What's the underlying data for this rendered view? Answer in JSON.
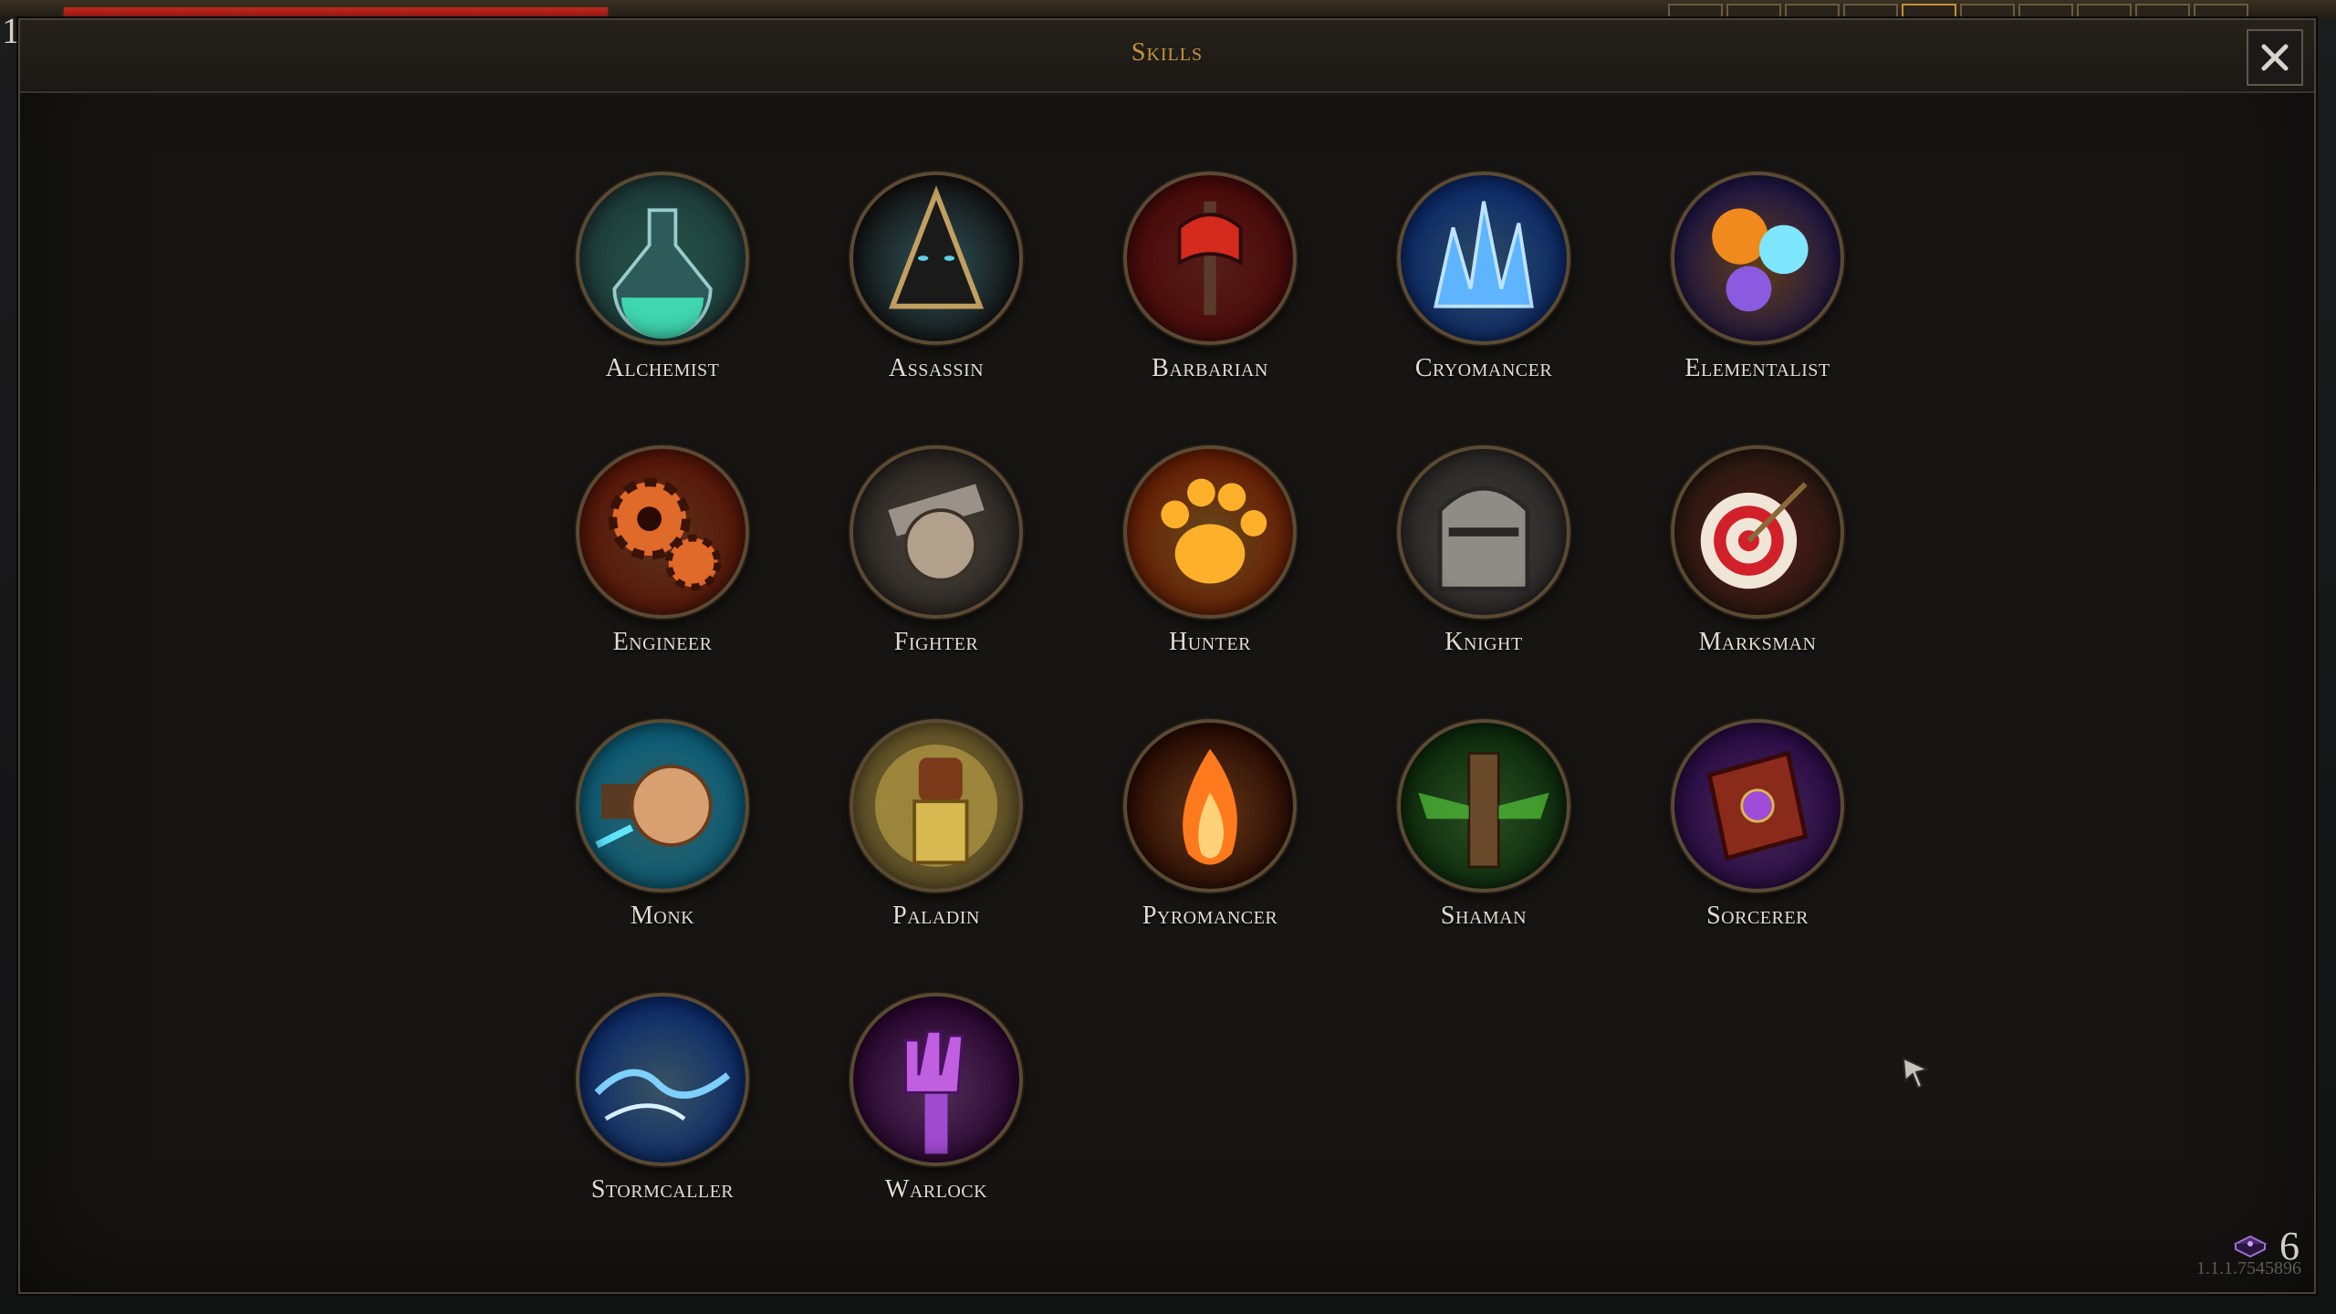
{
  "hud": {
    "level": "1",
    "slots": [
      false,
      false,
      false,
      false,
      true,
      false,
      false,
      false,
      false,
      false
    ]
  },
  "panel": {
    "title": "Skills",
    "close_icon": "close-icon"
  },
  "skills": [
    {
      "label": "Alchemist",
      "icon": "potion-flask-icon",
      "colors": [
        "#1e3b3a",
        "#3fd6b0"
      ]
    },
    {
      "label": "Assassin",
      "icon": "hooded-figure-icon",
      "colors": [
        "#141414",
        "#5fd0e6"
      ]
    },
    {
      "label": "Barbarian",
      "icon": "battle-axe-icon",
      "colors": [
        "#4a0a0a",
        "#d42b1e"
      ]
    },
    {
      "label": "Cryomancer",
      "icon": "ice-crystal-icon",
      "colors": [
        "#0b2a6b",
        "#5fb4ff"
      ]
    },
    {
      "label": "Elementalist",
      "icon": "elemental-orbs-icon",
      "colors": [
        "#1e1646",
        "#f08a1c"
      ]
    },
    {
      "label": "Engineer",
      "icon": "gears-icon",
      "colors": [
        "#5a1608",
        "#e06a2a"
      ]
    },
    {
      "label": "Fighter",
      "icon": "gauntlet-fist-icon",
      "colors": [
        "#2a2622",
        "#b0a08c"
      ]
    },
    {
      "label": "Hunter",
      "icon": "paw-print-icon",
      "colors": [
        "#6a1e04",
        "#ffb02a"
      ]
    },
    {
      "label": "Knight",
      "icon": "knight-helmet-icon",
      "colors": [
        "#2c2a28",
        "#8f8c86"
      ]
    },
    {
      "label": "Marksman",
      "icon": "target-arrow-icon",
      "colors": [
        "#2a1a10",
        "#d2202a"
      ]
    },
    {
      "label": "Monk",
      "icon": "fist-icon",
      "colors": [
        "#0b5f7a",
        "#5fe6ff"
      ]
    },
    {
      "label": "Paladin",
      "icon": "golden-gauntlet-icon",
      "colors": [
        "#6a5a2a",
        "#d8b850"
      ]
    },
    {
      "label": "Pyromancer",
      "icon": "flame-icon",
      "colors": [
        "#2a0c04",
        "#ff7a1c"
      ]
    },
    {
      "label": "Shaman",
      "icon": "totem-icon",
      "colors": [
        "#0c2a0c",
        "#52c43a"
      ]
    },
    {
      "label": "Sorcerer",
      "icon": "spellbook-icon",
      "colors": [
        "#2a0c46",
        "#a04ad8"
      ]
    },
    {
      "label": "Stormcaller",
      "icon": "lightning-icon",
      "colors": [
        "#0b2a6b",
        "#7fd0ff"
      ]
    },
    {
      "label": "Warlock",
      "icon": "cursed-hand-icon",
      "colors": [
        "#2a0630",
        "#c060e0"
      ]
    }
  ],
  "currency": {
    "icon": "skill-book-currency-icon",
    "count": "6"
  },
  "version": "1.1.1.7545896"
}
